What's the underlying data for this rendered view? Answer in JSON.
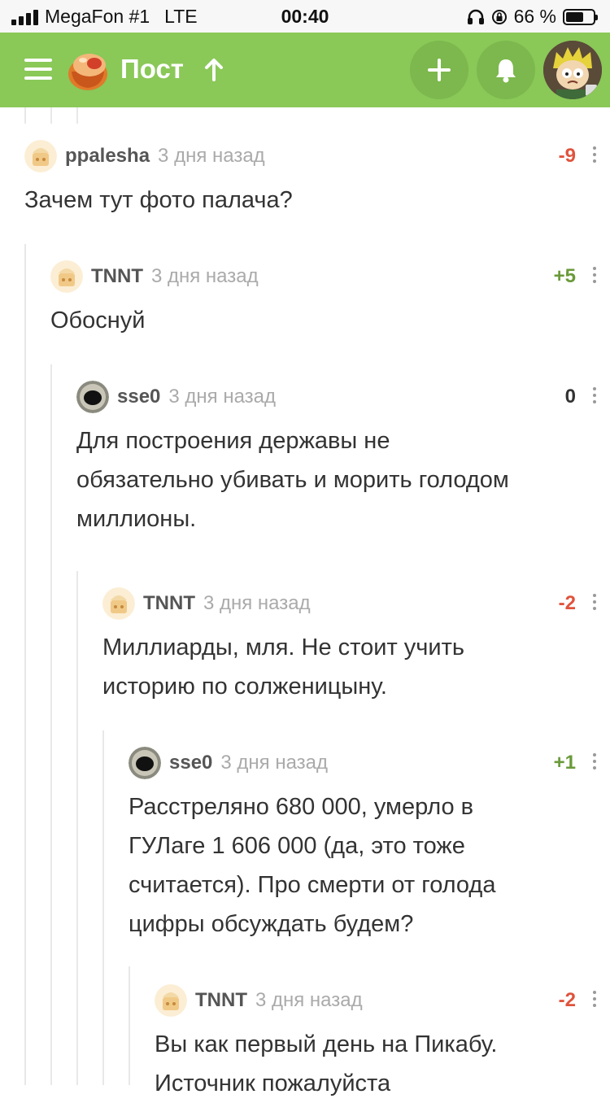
{
  "status_bar": {
    "carrier": "MegaFon #1",
    "network": "LTE",
    "time": "00:40",
    "battery_percent": "66 %",
    "battery_level": 0.66
  },
  "header": {
    "title": "Пост",
    "icons": [
      "menu-icon",
      "pikabu-logo",
      "arrow-up-icon",
      "plus-icon",
      "bell-icon"
    ],
    "accent_color": "#8ac858"
  },
  "comments": [
    {
      "user": "ppalesha",
      "time": "3 дня назад",
      "rating": "-9",
      "text": "Зачем тут фото палача?"
    },
    {
      "user": "TNNT",
      "time": "3 дня назад",
      "rating": "+5",
      "text": "Обоснуй"
    },
    {
      "user": "sse0",
      "time": "3 дня назад",
      "rating": "0",
      "text": "Для построения державы не\nобязательно убивать и морить голодом\nмиллионы."
    },
    {
      "user": "TNNT",
      "time": "3 дня назад",
      "rating": "-2",
      "text": "Миллиарды, мля. Не стоит учить\nисторию по солженицыну."
    },
    {
      "user": "sse0",
      "time": "3 дня назад",
      "rating": "+1",
      "text": "Расстреляно 680 000, умерло в\nГУЛаге 1 606 000 (да, это тоже\nсчитается). Про смерти от голода\nцифры обсуждать будем?"
    },
    {
      "user": "TNNT",
      "time": "3 дня назад",
      "rating": "-2",
      "text": "Вы как первый день на Пикабу.\nИсточник пожалуйста"
    }
  ]
}
